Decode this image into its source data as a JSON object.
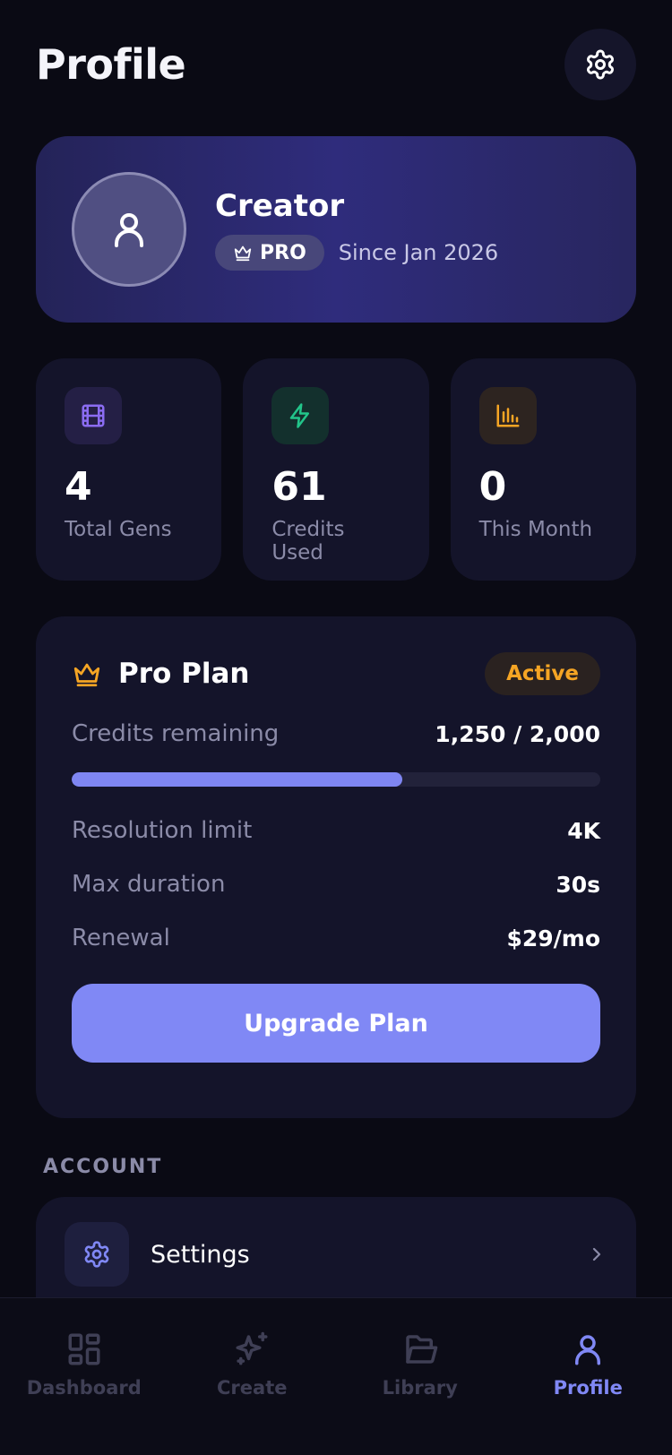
{
  "header": {
    "title": "Profile",
    "settings_icon": "gear-icon"
  },
  "profile": {
    "name": "Creator",
    "badge": "PRO",
    "since": "Since Jan 2026",
    "avatar_icon": "user-icon",
    "badge_icon": "crown-icon"
  },
  "stats": [
    {
      "value": "4",
      "label": "Total Gens",
      "icon": "film-icon",
      "color": "#8b6cf2"
    },
    {
      "value": "61",
      "label": "Credits Used",
      "icon": "lightning-icon",
      "color": "#22c58a"
    },
    {
      "value": "0",
      "label": "This Month",
      "icon": "bar-chart-icon",
      "color": "#f5a524"
    }
  ],
  "plan": {
    "title": "Pro Plan",
    "status": "Active",
    "credits_label": "Credits remaining",
    "credits_value": "1,250 / 2,000",
    "credits_fraction": 0.625,
    "rows": [
      {
        "label": "Resolution limit",
        "value": "4K"
      },
      {
        "label": "Max duration",
        "value": "30s"
      },
      {
        "label": "Renewal",
        "value": "$29/mo"
      }
    ],
    "upgrade_label": "Upgrade Plan",
    "icon": "crown-icon",
    "accent": "#f5a524"
  },
  "account": {
    "heading": "ACCOUNT",
    "items": [
      {
        "label": "Settings",
        "icon": "gear-icon"
      }
    ]
  },
  "nav": [
    {
      "label": "Dashboard",
      "icon": "dashboard-icon",
      "active": false
    },
    {
      "label": "Create",
      "icon": "sparkle-icon",
      "active": false
    },
    {
      "label": "Library",
      "icon": "folder-icon",
      "active": false
    },
    {
      "label": "Profile",
      "icon": "user-icon",
      "active": true
    }
  ],
  "colors": {
    "background": "#0a0a14",
    "card": "#14142a",
    "accent": "#8088f5",
    "muted": "#8b8ba8"
  }
}
